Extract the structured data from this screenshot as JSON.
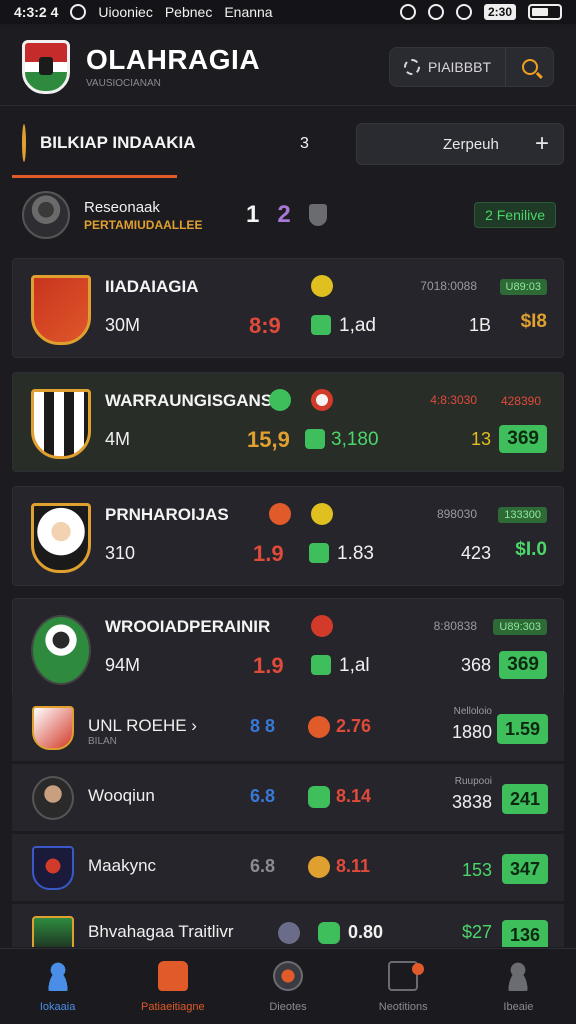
{
  "status_bar": {
    "time": "4:3:2 4",
    "carrier": "Uiooniec",
    "label_1": "Pebnec",
    "label_2": "Enanna",
    "battery_pct": "2:30"
  },
  "header": {
    "title": "OLAHRAGIA",
    "subtitle": "VAUSIOCIANAN",
    "settings_label": "PIAIBBBT"
  },
  "team_bar": {
    "name": "BILKIAP INDAAKIA",
    "count": "3",
    "button_label": "Zerpeuh",
    "button_icon": "+"
  },
  "player_strip": {
    "name": "Reseonaak",
    "sub": "PERTAMIUDAALLEE",
    "score_a": "1",
    "score_b": "2",
    "badge": "2 Fenilive"
  },
  "cards": [
    {
      "title": "IIADAIAGIA",
      "left_val": "30M",
      "num_a": "8:9",
      "num_a_color": "#e04a3a",
      "num_b": "1,ad",
      "meta": "7018:0088",
      "tag": "U89:03",
      "count": "1B",
      "price": "$I8",
      "price_boxed": false,
      "price_color": "#e0a030"
    },
    {
      "title": "WARRAUNGISGANS",
      "left_val": "4M",
      "num_a": "15,9",
      "num_a_color": "#e0a030",
      "num_b": "3,180",
      "meta": "4:8:3030",
      "tag": "428390",
      "count": "13",
      "price": "369",
      "price_boxed": true,
      "price_color": "#0c2810"
    },
    {
      "title": "PRNHAROIJAS",
      "left_val": "310",
      "num_a": "1.9",
      "num_a_color": "#e04a3a",
      "num_b": "1.83",
      "meta": "898030",
      "tag": "133300",
      "count": "423",
      "price": "$I.0",
      "price_boxed": false,
      "price_color": "#4bd66a"
    },
    {
      "title": "WROOIADPERAINIR",
      "left_val": "94M",
      "num_a": "1.9",
      "num_a_color": "#e04a3a",
      "num_b": "1,al",
      "meta": "8:80838",
      "tag": "U89:303",
      "count": "368",
      "price": "369",
      "price_boxed": true,
      "price_color": "#0c2810"
    }
  ],
  "rows": [
    {
      "name": "UNL ROEHE ›",
      "sub": "BILAN",
      "num1": "8 8",
      "num1_color": "#3a78d8",
      "num2": "2.76",
      "num2_color": "#e04a3a",
      "meta": "Nelloloio",
      "count": "1880",
      "price": "1.59"
    },
    {
      "name": "Wooqiun",
      "sub": "",
      "num1": "6.8",
      "num1_color": "#3a78d8",
      "num2": "8.14",
      "num2_color": "#e04a3a",
      "meta": "Ruupooi",
      "count": "3838",
      "price": "241"
    },
    {
      "name": "Maakync",
      "sub": "",
      "num1": "6.8",
      "num1_color": "#8b8b92",
      "num2": "8.11",
      "num2_color": "#e04a3a",
      "meta": "",
      "count": "153",
      "price": "347"
    },
    {
      "name": "Bhvahagaa Traitlivr",
      "sub": "",
      "num1": "",
      "num1_color": "#8b8b92",
      "num2": "0.80",
      "num2_color": "#f0f0f0",
      "meta": "",
      "count": "$27",
      "price": "136"
    }
  ],
  "bottom_nav": [
    {
      "label": "Iokaaia",
      "icon": "person-icon"
    },
    {
      "label": "Patiaeitiagne",
      "icon": "bag-icon"
    },
    {
      "label": "Dieotes",
      "icon": "ball-icon"
    },
    {
      "label": "Neotitions",
      "icon": "bell-icon"
    },
    {
      "label": "Ibeaie",
      "icon": "profile-icon"
    }
  ],
  "colors": {
    "accent_orange": "#e05a2a",
    "gold": "#e0a030",
    "green": "#3fbf5c",
    "red": "#e04a3a",
    "blue": "#3a78d8"
  }
}
